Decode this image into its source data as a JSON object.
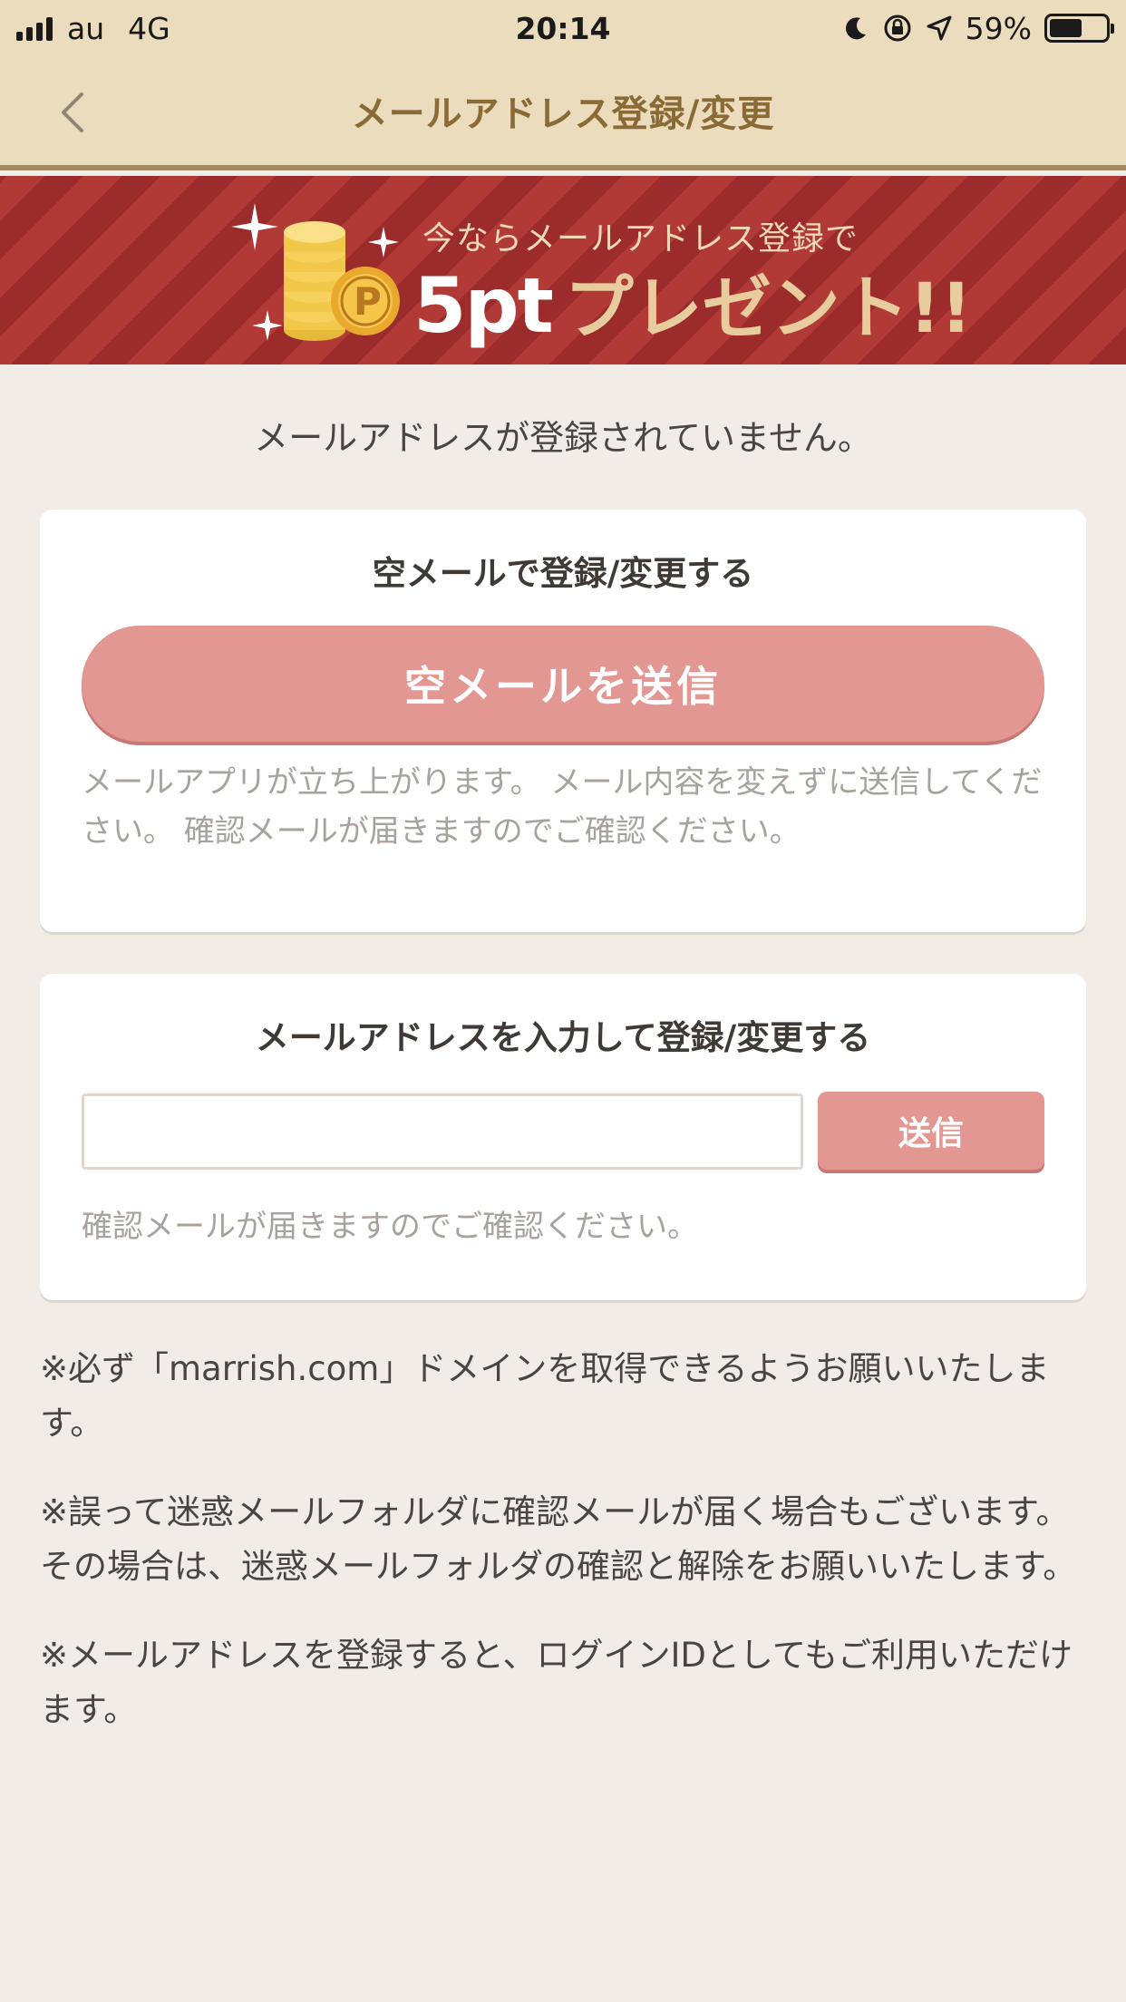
{
  "status_bar": {
    "carrier": "au",
    "network": "4G",
    "time": "20:14",
    "battery_percent": "59%",
    "battery_level": 0.59,
    "icons": [
      "moon-icon",
      "rotation-lock-icon",
      "location-arrow-icon"
    ]
  },
  "nav": {
    "title": "メールアドレス登録/変更",
    "back_icon": "chevron-left-icon"
  },
  "banner": {
    "line1": "今ならメールアドレス登録で",
    "points": "5pt",
    "present": "プレゼント!!",
    "coin_letter": "P"
  },
  "notice": "メールアドレスが登録されていません。",
  "empty_mail_card": {
    "title": "空メールで登録/変更する",
    "button_label": "空メールを送信",
    "note": "メールアプリが立ち上がります。 メール内容を変えずに送信してください。 確認メールが届きますのでご確認ください。"
  },
  "input_card": {
    "title": "メールアドレスを入力して登録/変更する",
    "input_value": "",
    "send_label": "送信",
    "note": "確認メールが届きますのでご確認ください。"
  },
  "footnotes": [
    "※必ず「marrish.com」ドメインを取得できるようお願いいたします。",
    "※誤って迷惑メールフォルダに確認メールが届く場合もございます。 その場合は、迷惑メールフォルダの確認と解除をお願いいたします。",
    "※メールアドレスを登録すると、ログインIDとしてもご利用いただけます。"
  ],
  "colors": {
    "header_bg": "#eadcbd",
    "header_title": "#8b6b35",
    "banner_red": "#9c2b2b",
    "button_pink": "#e29793",
    "page_bg": "#f1ece6"
  }
}
